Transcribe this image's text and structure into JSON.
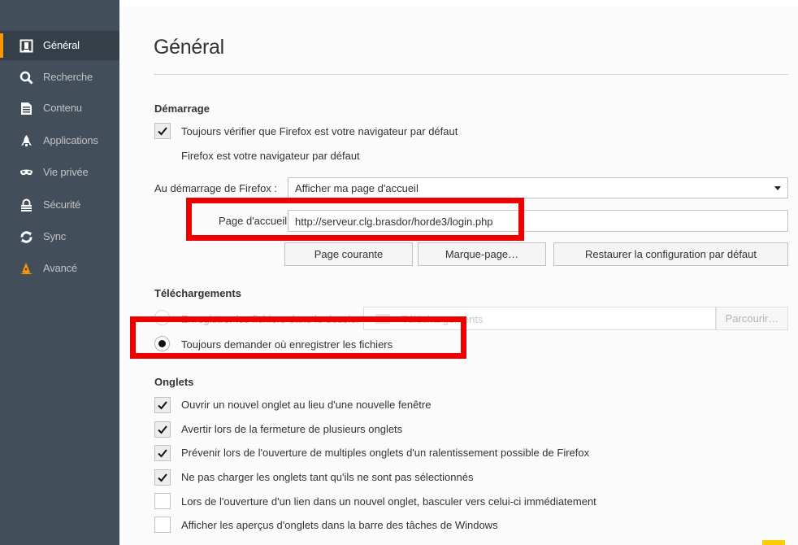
{
  "sidebar": {
    "items": [
      {
        "label": "Général",
        "icon": "general-icon",
        "active": true
      },
      {
        "label": "Recherche",
        "icon": "search-icon",
        "active": false
      },
      {
        "label": "Contenu",
        "icon": "document-icon",
        "active": false
      },
      {
        "label": "Applications",
        "icon": "rocket-icon",
        "active": false
      },
      {
        "label": "Vie privée",
        "icon": "mask-icon",
        "active": false
      },
      {
        "label": "Sécurité",
        "icon": "lock-icon",
        "active": false
      },
      {
        "label": "Sync",
        "icon": "sync-icon",
        "active": false
      },
      {
        "label": "Avancé",
        "icon": "wizard-hat-icon",
        "active": false
      }
    ]
  },
  "main": {
    "title": "Général",
    "startup": {
      "heading": "Démarrage",
      "default_check_label": "Toujours vérifier que Firefox est votre navigateur par défaut",
      "default_check_checked": true,
      "default_status": "Firefox est votre navigateur par défaut",
      "on_start_label": "Au démarrage de Firefox :",
      "on_start_value": "Afficher ma page d'accueil",
      "homepage_label": "Page d'accueil :",
      "homepage_value": "http://serveur.clg.brasdor/horde3/login.php",
      "buttons": {
        "current_page": "Page courante",
        "bookmark": "Marque-page…",
        "restore_default": "Restaurer la configuration par défaut"
      }
    },
    "downloads": {
      "heading": "Téléchargements",
      "save_to_label": "Enregistrer les fichiers dans le dossier",
      "save_to_folder": "Téléchargements",
      "browse_label": "Parcourir…",
      "always_ask_label": "Toujours demander où enregistrer les fichiers",
      "always_ask_selected": true
    },
    "tabs": {
      "heading": "Onglets",
      "options": [
        {
          "label": "Ouvrir un nouvel onglet au lieu d'une nouvelle fenêtre",
          "checked": true
        },
        {
          "label": "Avertir lors de la fermeture de plusieurs onglets",
          "checked": true
        },
        {
          "label": "Prévenir lors de l'ouverture de multiples onglets d'un ralentissement possible de Firefox",
          "checked": true
        },
        {
          "label": "Ne pas charger les onglets tant qu'ils ne sont pas sélectionnés",
          "checked": true
        },
        {
          "label": "Lors de l'ouverture d'un lien dans un nouvel onglet, basculer vers celui-ci immédiatement",
          "checked": false
        },
        {
          "label": "Afficher les aperçus d'onglets dans la barre des tâches de Windows",
          "checked": false
        }
      ]
    }
  },
  "colors": {
    "sidebar_bg": "#424f5a",
    "accent": "#ff9500",
    "highlight_box": "#ee0000"
  }
}
